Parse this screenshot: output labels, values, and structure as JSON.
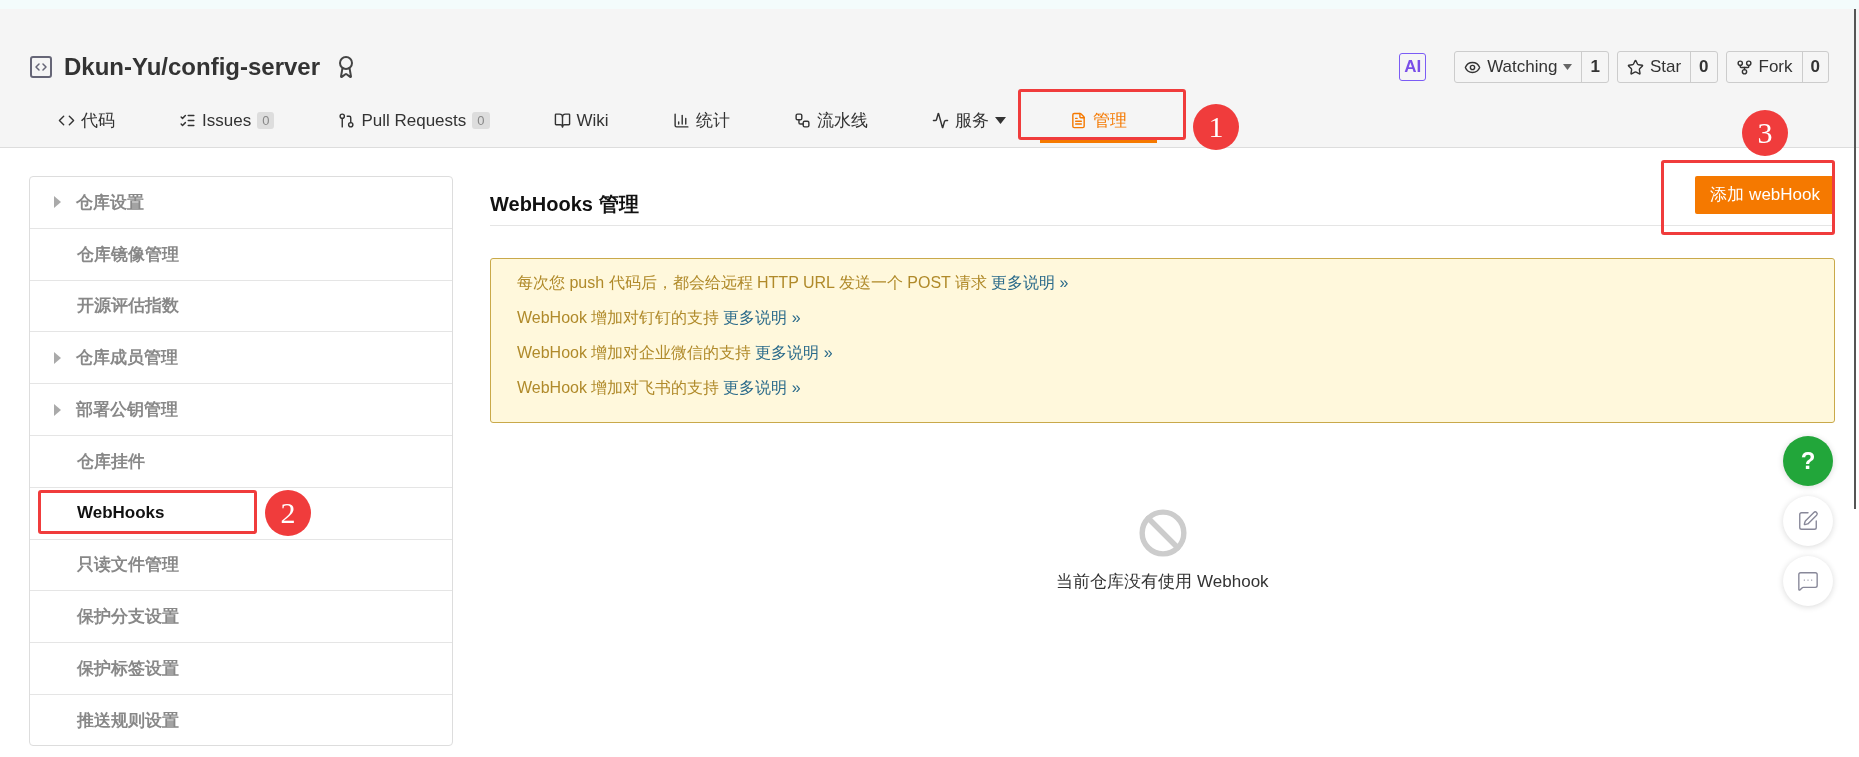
{
  "repo": {
    "title": "Dkun-Yu/config-server",
    "ai_badge": "AI",
    "actions": [
      {
        "kind": "watch",
        "label": "Watching",
        "count": "1"
      },
      {
        "kind": "star",
        "label": "Star",
        "count": "0"
      },
      {
        "kind": "fork",
        "label": "Fork",
        "count": "0"
      }
    ]
  },
  "tabs": [
    {
      "label": "代码",
      "selected": false
    },
    {
      "label": "Issues",
      "count": "0",
      "selected": false
    },
    {
      "label": "Pull Requests",
      "count": "0",
      "selected": false
    },
    {
      "label": "Wiki",
      "selected": false
    },
    {
      "label": "统计",
      "selected": false
    },
    {
      "label": "流水线",
      "selected": false
    },
    {
      "label": "服务",
      "dropdown": true,
      "selected": false
    },
    {
      "label": "管理",
      "selected": true
    }
  ],
  "sidebar": {
    "items": [
      {
        "label": "仓库设置",
        "expandable": true,
        "selected": false
      },
      {
        "label": "仓库镜像管理",
        "expandable": false,
        "selected": false
      },
      {
        "label": "开源评估指数",
        "expandable": false,
        "selected": false
      },
      {
        "label": "仓库成员管理",
        "expandable": true,
        "selected": false
      },
      {
        "label": "部署公钥管理",
        "expandable": true,
        "selected": false
      },
      {
        "label": "仓库挂件",
        "expandable": false,
        "selected": false
      },
      {
        "label": "WebHooks",
        "expandable": false,
        "selected": true
      },
      {
        "label": "只读文件管理",
        "expandable": false,
        "selected": false
      },
      {
        "label": "保护分支设置",
        "expandable": false,
        "selected": false
      },
      {
        "label": "保护标签设置",
        "expandable": false,
        "selected": false
      },
      {
        "label": "推送规则设置",
        "expandable": false,
        "selected": false
      }
    ]
  },
  "main": {
    "heading": "WebHooks 管理",
    "add_button": "添加 webHook",
    "notices": [
      {
        "text": "每次您 push 代码后，都会给远程 HTTP URL 发送一个 POST 请求",
        "link": "更多说明 »"
      },
      {
        "text": "WebHook 增加对钉钉的支持",
        "link": "更多说明 »"
      },
      {
        "text": "WebHook 增加对企业微信的支持",
        "link": "更多说明 »"
      },
      {
        "text": "WebHook 增加对飞书的支持",
        "link": "更多说明 »"
      }
    ],
    "empty_text": "当前仓库没有使用 Webhook"
  },
  "floating": [
    {
      "kind": "help",
      "label": "?"
    },
    {
      "kind": "edit"
    },
    {
      "kind": "chat"
    }
  ],
  "annotations": [
    {
      "number": "1"
    },
    {
      "number": "2"
    },
    {
      "number": "3"
    }
  ]
}
